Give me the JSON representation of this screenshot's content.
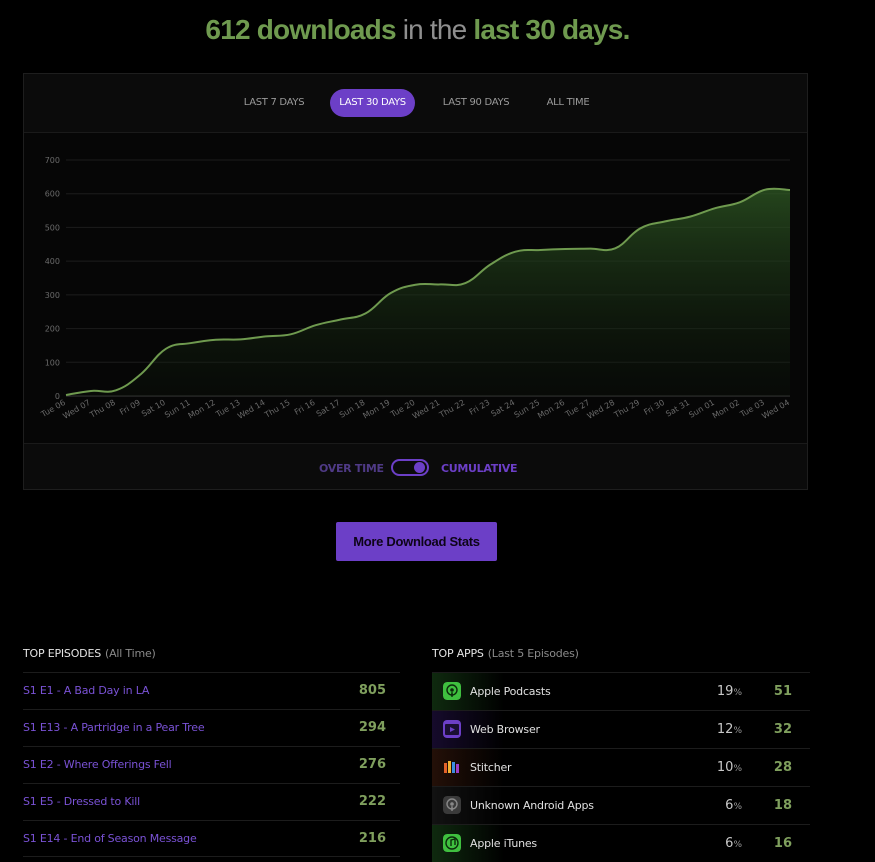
{
  "headline": {
    "count": "612 downloads",
    "mid": " in the ",
    "period": "last 30 days."
  },
  "tabs": [
    {
      "label": "LAST 7 DAYS",
      "active": false
    },
    {
      "label": "LAST 30 DAYS",
      "active": true
    },
    {
      "label": "LAST 90 DAYS",
      "active": false
    },
    {
      "label": "ALL TIME",
      "active": false
    }
  ],
  "chart_data": {
    "type": "area",
    "y_ticks": [
      0,
      100,
      200,
      300,
      400,
      500,
      600,
      700
    ],
    "ylim": [
      0,
      700
    ],
    "grid": true,
    "categories": [
      "Tue 06",
      "Wed 07",
      "Thu 08",
      "Fri 09",
      "Sat 10",
      "Sun 11",
      "Mon 12",
      "Tue 13",
      "Wed 14",
      "Thu 15",
      "Fri 16",
      "Sat 17",
      "Sun 18",
      "Mon 19",
      "Tue 20",
      "Wed 21",
      "Thu 22",
      "Fri 23",
      "Sat 24",
      "Sun 25",
      "Mon 26",
      "Tue 27",
      "Wed 28",
      "Thu 29",
      "Fri 30",
      "Sat 31",
      "Sun 01",
      "Mon 02",
      "Tue 03",
      "Wed 04"
    ],
    "values": [
      3,
      15,
      17,
      65,
      140,
      157,
      167,
      168,
      177,
      183,
      210,
      227,
      245,
      305,
      330,
      331,
      335,
      390,
      428,
      433,
      436,
      437,
      438,
      497,
      518,
      532,
      557,
      575,
      612,
      611
    ],
    "colors": {
      "line": "#6f9a4f",
      "fill": "#2a4a22"
    }
  },
  "toggle": {
    "left": "OVER TIME",
    "right": "CUMULATIVE",
    "mode": "cumulative"
  },
  "more_button": "More Download Stats",
  "top_episodes": {
    "title": "TOP EPISODES",
    "subtitle": "(All Time)",
    "items": [
      {
        "title": "S1 E1 - A Bad Day in LA",
        "count": "805"
      },
      {
        "title": "S1 E13 - A Partridge in a Pear Tree",
        "count": "294"
      },
      {
        "title": "S1 E2 - Where Offerings Fell",
        "count": "276"
      },
      {
        "title": "S1 E5 - Dressed to Kill",
        "count": "222"
      },
      {
        "title": "S1 E14 - End of Season Message",
        "count": "216"
      }
    ]
  },
  "top_apps": {
    "title": "TOP APPS",
    "subtitle": "(Last 5 Episodes)",
    "items": [
      {
        "name": "Apple Podcasts",
        "pct": "19",
        "pct_unit": "%",
        "count": "51",
        "icon": "apple-podcasts-icon",
        "color": "#3fbf3f",
        "glow": "#0f2a0f"
      },
      {
        "name": "Web Browser",
        "pct": "12",
        "pct_unit": "%",
        "count": "32",
        "icon": "web-browser-icon",
        "color": "#6c3fc7",
        "glow": "#160b2c"
      },
      {
        "name": "Stitcher",
        "pct": "10",
        "pct_unit": "%",
        "count": "28",
        "icon": "stitcher-icon",
        "color": "#e2622a",
        "glow": "#241008"
      },
      {
        "name": "Unknown Android Apps",
        "pct": "6",
        "pct_unit": "%",
        "count": "18",
        "icon": "unknown-android-icon",
        "color": "#777777",
        "glow": "#121212"
      },
      {
        "name": "Apple iTunes",
        "pct": "6",
        "pct_unit": "%",
        "count": "16",
        "icon": "apple-itunes-icon",
        "color": "#3fbf3f",
        "glow": "#0f2a0f"
      }
    ]
  }
}
